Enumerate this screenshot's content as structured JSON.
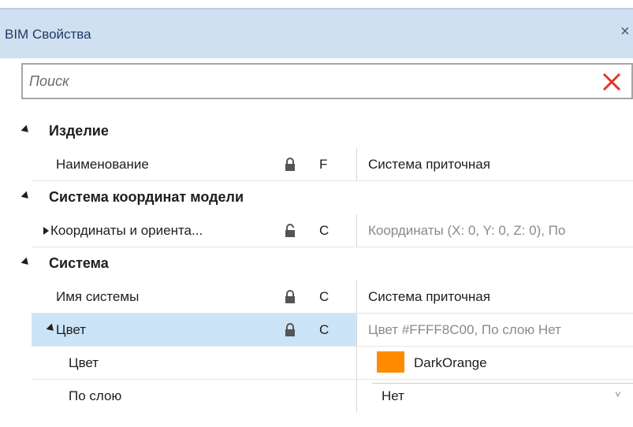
{
  "window": {
    "title": "BIM Свойства",
    "close_glyph": "×"
  },
  "search": {
    "placeholder": "Поиск",
    "value": ""
  },
  "categories": [
    {
      "label": "Изделие"
    },
    {
      "label": "Система координат модели"
    },
    {
      "label": "Система"
    }
  ],
  "properties": {
    "name": {
      "label": "Наименование",
      "flag": "F",
      "value": "Система приточная",
      "locked": true
    },
    "coords": {
      "label": "Координаты и ориента...",
      "flag": "C",
      "value": "Координаты (X: 0, Y: 0, Z: 0), По",
      "locked": false
    },
    "system_name": {
      "label": "Имя системы",
      "flag": "C",
      "value": "Система приточная",
      "locked": true
    },
    "color": {
      "label": "Цвет",
      "flag": "C",
      "value": "Цвет #FFFF8C00, По слою Нет",
      "locked": true
    },
    "color_sub": {
      "label": "Цвет",
      "value": "DarkOrange",
      "swatch": "#FF8C00"
    },
    "by_layer": {
      "label": "По слою",
      "value": "Нет"
    }
  },
  "colors": {
    "titlebar": "#cfe0f1",
    "selected_row": "#cce4f7",
    "clear_icon": "#e0362c"
  }
}
